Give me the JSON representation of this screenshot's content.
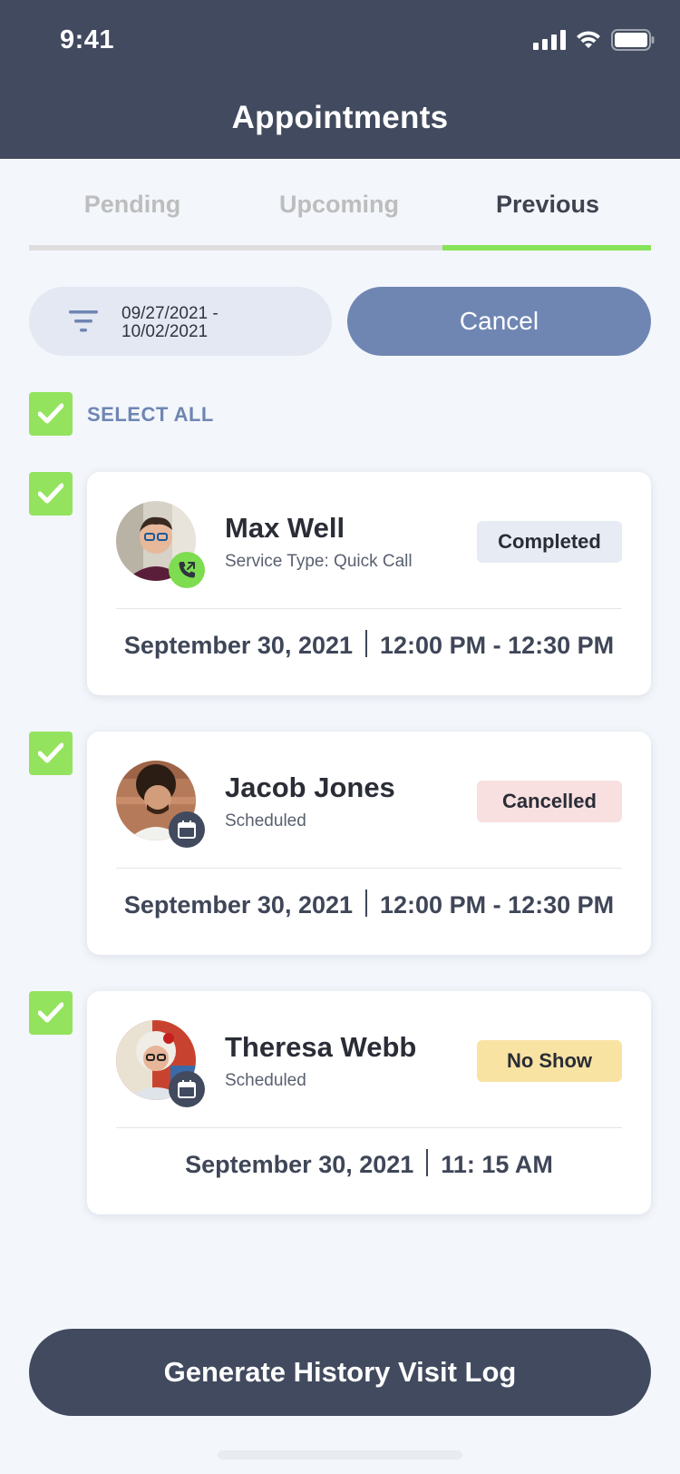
{
  "status_bar": {
    "time": "9:41"
  },
  "header": {
    "title": "Appointments"
  },
  "tabs": [
    {
      "label": "Pending",
      "active": false
    },
    {
      "label": "Upcoming",
      "active": false
    },
    {
      "label": "Previous",
      "active": true
    }
  ],
  "filter": {
    "date_range_line1": "09/27/2021 -",
    "date_range_line2": "10/02/2021",
    "icon": "filter-icon"
  },
  "cancel_button": {
    "label": "Cancel"
  },
  "select_all": {
    "label": "SELECT ALL",
    "checked": true
  },
  "appointments": [
    {
      "name": "Max Well",
      "subtitle": "Service Type: Quick Call",
      "status": "Completed",
      "date": "September 30, 2021",
      "time": "12:00 PM - 12:30 PM",
      "checked": true,
      "badge_icon": "phone-icon"
    },
    {
      "name": "Jacob Jones",
      "subtitle": "Scheduled",
      "status": "Cancelled",
      "date": "September 30, 2021",
      "time": "12:00 PM - 12:30 PM",
      "checked": true,
      "badge_icon": "calendar-icon"
    },
    {
      "name": "Theresa Webb",
      "subtitle": "Scheduled",
      "status": "No Show",
      "date": "September 30, 2021",
      "time": "11: 15 AM",
      "checked": true,
      "badge_icon": "calendar-icon"
    }
  ],
  "generate_button": {
    "label": "Generate History Visit Log"
  },
  "colors": {
    "header_bg": "#414a5e",
    "accent_green": "#86e35a",
    "button_blue": "#6f86b3",
    "completed_bg": "#e6ebf4",
    "cancelled_bg": "#f8dfe0",
    "noshow_bg": "#f9e3a3"
  }
}
